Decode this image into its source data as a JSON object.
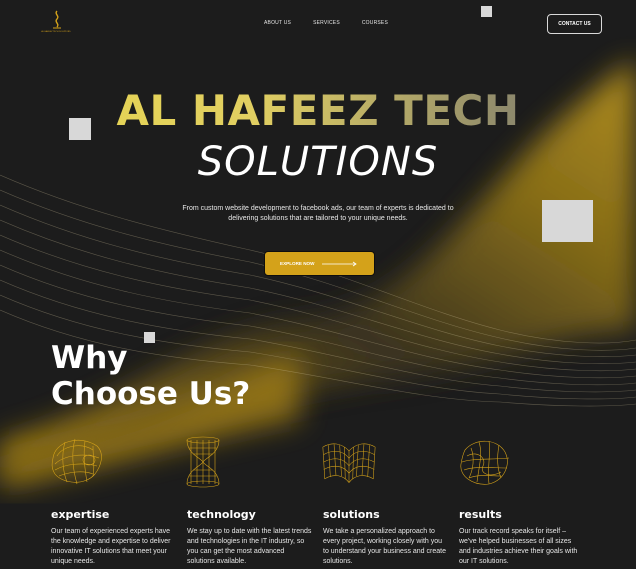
{
  "brand": {
    "logo_text": "AL HAFEEZ TECH SOLUTIONS",
    "accent": "#d4a21a"
  },
  "nav": {
    "items": [
      {
        "label": "ABOUT US"
      },
      {
        "label": "SERVICES"
      },
      {
        "label": "COURSES"
      }
    ],
    "contact_label": "CONTACT US"
  },
  "hero": {
    "title": "AL HAFEEZ TECH",
    "subtitle": "SOLUTIONS",
    "description": "From custom website development to facebook ads, our team of experts is dedicated to delivering solutions that are tailored to your unique needs.",
    "cta_label": "EXPLORE NOW"
  },
  "why": {
    "title_line1": "Why",
    "title_line2": "Choose Us?"
  },
  "features": [
    {
      "icon": "wireframe-blob-icon",
      "title": "expertise",
      "description": "Our team of experienced experts have the knowledge and expertise to deliver innovative IT solutions that meet your unique needs."
    },
    {
      "icon": "wireframe-hourglass-icon",
      "title": "technology",
      "description": "We stay up to date with the latest trends and technologies in the IT industry, so you can get the most advanced solutions available."
    },
    {
      "icon": "wireframe-book-icon",
      "title": "solutions",
      "description": "We take a personalized approach to every project, working closely with you to understand your business and create solutions."
    },
    {
      "icon": "wireframe-torus-icon",
      "title": "results",
      "description": "Our track record speaks for itself – we've helped businesses of all sizes and industries achieve their goals with our IT solutions."
    }
  ]
}
